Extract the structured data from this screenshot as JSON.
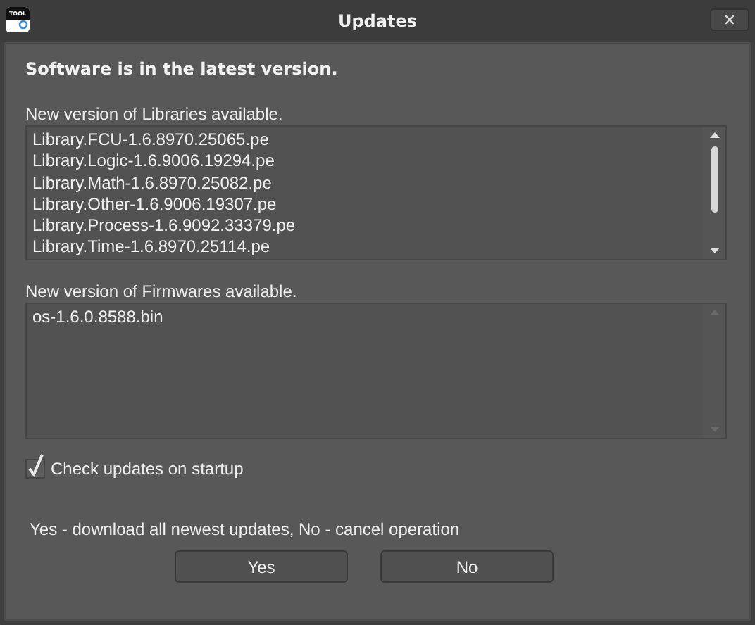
{
  "window": {
    "title": "Updates",
    "icon_label": "TOOL",
    "close": "✕"
  },
  "status": "Software is in the latest version.",
  "libraries": {
    "label": "New version of Libraries available.",
    "items": [
      "Library.FCU-1.6.8970.25065.pe",
      "Library.Logic-1.6.9006.19294.pe",
      "Library.Math-1.6.8970.25082.pe",
      "Library.Other-1.6.9006.19307.pe",
      "Library.Process-1.6.9092.33379.pe",
      "Library.Time-1.6.8970.25114.pe"
    ],
    "scroll": true
  },
  "firmwares": {
    "label": "New version of Firmwares available.",
    "items": [
      "os-1.6.0.8588.bin"
    ],
    "scroll": false
  },
  "startup_check": {
    "label": "Check updates on startup",
    "checked": true
  },
  "hint": "Yes - download all newest updates, No - cancel operation",
  "buttons": [
    "Yes",
    "No"
  ]
}
